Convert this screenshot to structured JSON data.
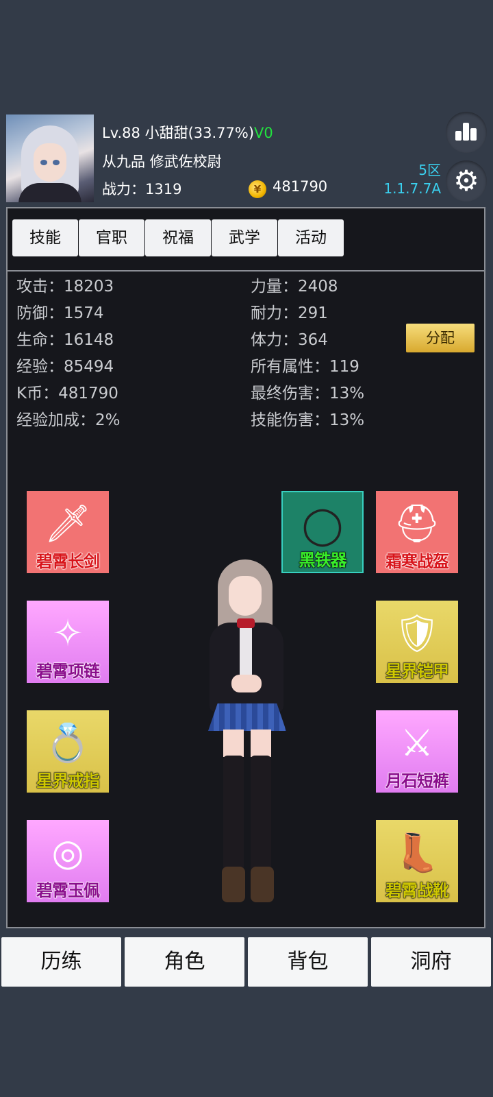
{
  "player": {
    "level_name": "Lv.88 小甜甜(33.77%)",
    "vip": "V0",
    "rank_title": "从九品 修武佐校尉",
    "power": "战力：1319",
    "gold": "481790",
    "server": "5区",
    "version": "1.1.7.7A"
  },
  "tabs": [
    "技能",
    "官职",
    "祝福",
    "武学",
    "活动"
  ],
  "stats_left": [
    "攻击：18203",
    "防御：1574",
    "生命：16148",
    "经验：85494",
    "K币：481790",
    "经验加成：2%"
  ],
  "stats_right": [
    "力量：2408",
    "耐力：291",
    "体力：364",
    "所有属性：119",
    "最终伤害：13%",
    "技能伤害：13%"
  ],
  "assign_label": "分配",
  "equipment": [
    {
      "name": "碧霄长剑",
      "icon": "sword-icon"
    },
    {
      "name": "碧霄项链",
      "icon": "necklace-icon"
    },
    {
      "name": "星界戒指",
      "icon": "ring-icon"
    },
    {
      "name": "碧霄玉佩",
      "icon": "jade-pendant-icon"
    },
    {
      "name": "黑铁器",
      "icon": "iron-ring-icon"
    },
    {
      "name": "霜寒战盔",
      "icon": "helmet-icon"
    },
    {
      "name": "星界铠甲",
      "icon": "armor-icon"
    },
    {
      "name": "月石短裤",
      "icon": "leg-guard-icon"
    },
    {
      "name": "碧霄战靴",
      "icon": "boots-icon"
    }
  ],
  "nav": [
    "历练",
    "角色",
    "背包",
    "洞府"
  ],
  "icons": {
    "leaderboard": "bar-chart-icon",
    "settings": "gear-icon",
    "coin": "gold-coin-icon"
  },
  "colors": {
    "background": "#333b48",
    "panel": "#16171c",
    "vip": "#21e23e",
    "server": "#3ad1f0"
  }
}
